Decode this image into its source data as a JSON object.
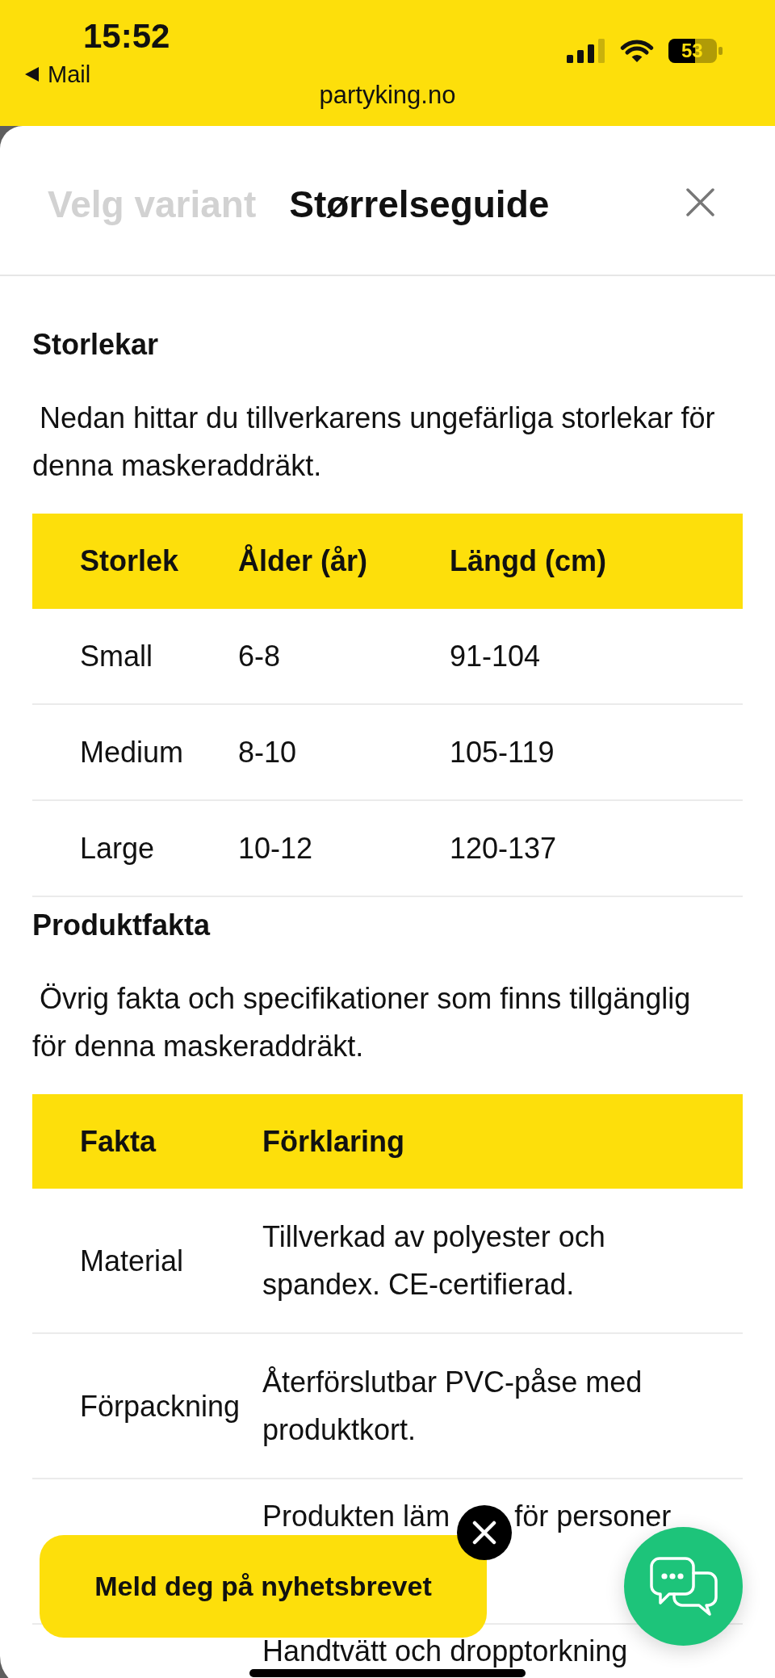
{
  "status_bar": {
    "time": "15:52",
    "back_link": "Mail",
    "battery_percent": "53"
  },
  "address_bar": {
    "url": "partyking.no"
  },
  "tabs": [
    {
      "label": "Velg variant",
      "selected": false
    },
    {
      "label": "Størrelseguide",
      "selected": true
    }
  ],
  "sizes": {
    "title": "Storlekar",
    "intro": "Nedan hittar du tillverkarens ungefärliga storlekar för denna maskeraddräkt.",
    "columns": [
      "Storlek",
      "Ålder (år)",
      "Längd (cm)"
    ],
    "rows": [
      [
        "Small",
        "6-8",
        "91-104"
      ],
      [
        "Medium",
        "8-10",
        "105-119"
      ],
      [
        "Large",
        "10-12",
        "120-137"
      ]
    ]
  },
  "facts": {
    "title": "Produktfakta",
    "intro": "Övrig fakta och specifikationer som finns tillgänglig för denna maskeraddräkt.",
    "columns": [
      "Fakta",
      "Förklaring"
    ],
    "rows": [
      {
        "label": "Material",
        "value": "Tillverkad av polyester och spandex. CE-certifierad."
      },
      {
        "label": "Förpackning",
        "value": "Återförslutbar PVC-påse med produktkort."
      },
      {
        "value_fragments": [
          "Produkten läm",
          "för personer"
        ]
      },
      {
        "value": "Handtvätt och dropptorkning"
      }
    ]
  },
  "newsletter_banner": {
    "label": "Meld deg på nyhetsbrevet"
  }
}
